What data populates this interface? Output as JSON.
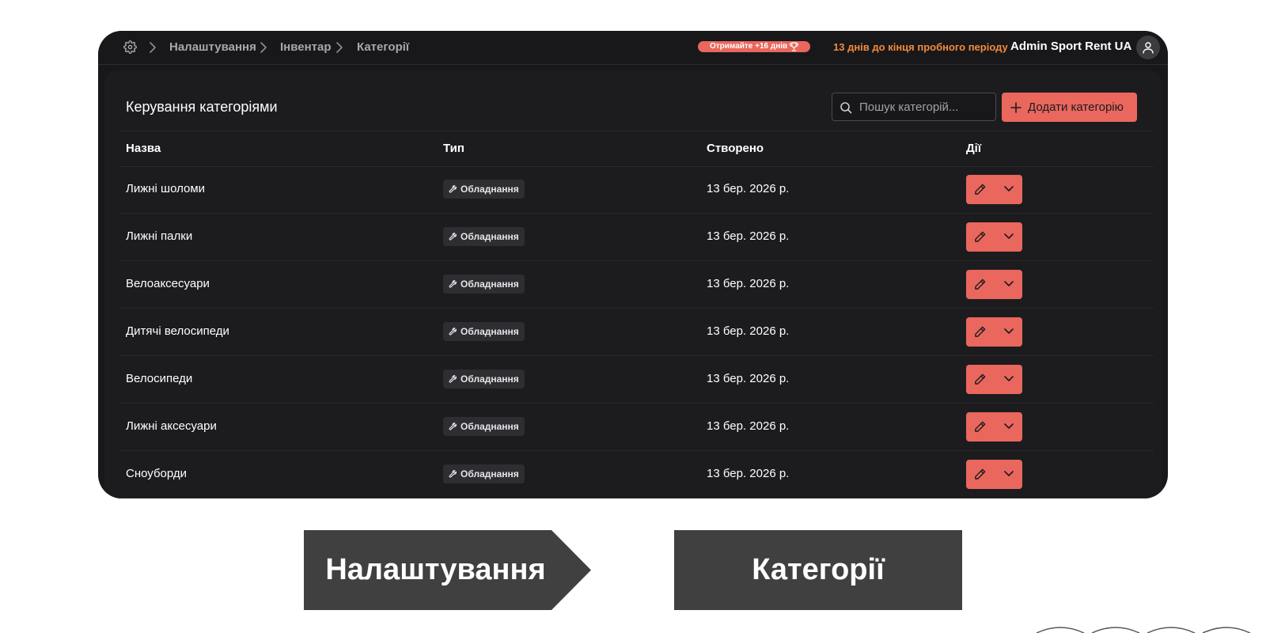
{
  "topbar": {
    "breadcrumb": [
      "Налаштування",
      "Інвентар",
      "Категорії"
    ],
    "promo_label": "Отримайте +16 днів",
    "trial_text": "13 днів до кінця пробного періоду",
    "company_name": "Admin Sport Rent UA"
  },
  "panel": {
    "title": "Керування категоріями",
    "search_placeholder": "Пошук категорій...",
    "add_button_label": "Додати категорію"
  },
  "table": {
    "columns": [
      "Назва",
      "Тип",
      "Створено",
      "Дії"
    ],
    "rows": [
      {
        "name": "Лижні шоломи",
        "type": "Обладнання",
        "created": "13 бер. 2026 р."
      },
      {
        "name": "Лижні палки",
        "type": "Обладнання",
        "created": "13 бер. 2026 р."
      },
      {
        "name": "Велоаксесуари",
        "type": "Обладнання",
        "created": "13 бер. 2026 р."
      },
      {
        "name": "Дитячі велосипеди",
        "type": "Обладнання",
        "created": "13 бер. 2026 р."
      },
      {
        "name": "Велосипеди",
        "type": "Обладнання",
        "created": "13 бер. 2026 р."
      },
      {
        "name": "Лижні аксесуари",
        "type": "Обладнання",
        "created": "13 бер. 2026 р."
      },
      {
        "name": "Сноуборди",
        "type": "Обладнання",
        "created": "13 бер. 2026 р."
      }
    ]
  },
  "callouts": {
    "left_label": "Налаштування",
    "right_label": "Категорії"
  },
  "icons": {
    "settings": "gear-icon",
    "breadcrumb_separator": "chevron-right-icon",
    "promo": "trophy-icon",
    "user": "user-icon",
    "search": "search-icon",
    "add": "plus-icon",
    "type": "wrench-icon",
    "edit": "pencil-icon",
    "more": "chevron-down-icon"
  },
  "colors": {
    "accent": "#e9675d",
    "trial_text": "#f38a3c",
    "background": "#18181a",
    "callout": "#404040"
  }
}
